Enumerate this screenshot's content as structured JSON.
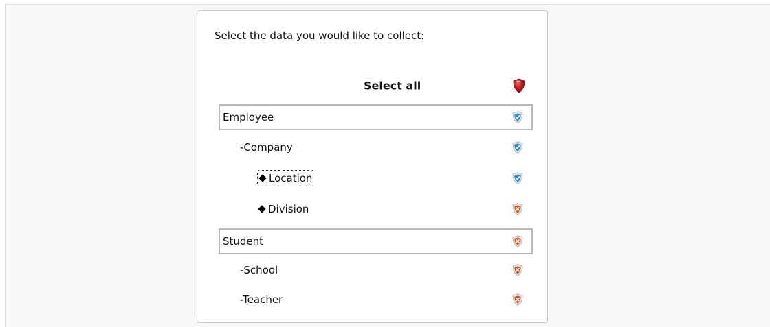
{
  "prompt_text": "Select the data you would like to collect:",
  "select_all": {
    "label": "Select all",
    "state": "partial",
    "icon": "shield-red-icon"
  },
  "colors": {
    "allowed_shield": "#2a8fc4",
    "blocked_shield": "#d9531e",
    "partial_shield": "#c21f1f",
    "group_border": "#b9b9b9"
  },
  "tree": [
    {
      "label": "Employee",
      "kind": "group",
      "state": "allowed",
      "icon": "shield-check-icon"
    },
    {
      "label": "-Company",
      "kind": "level1",
      "state": "allowed",
      "icon": "shield-check-icon"
    },
    {
      "label": "Location",
      "kind": "level2",
      "state": "allowed",
      "icon": "shield-check-icon",
      "bullet": "diamond",
      "focused": true
    },
    {
      "label": "Division",
      "kind": "level2",
      "state": "blocked",
      "icon": "shield-x-icon",
      "bullet": "diamond"
    },
    {
      "label": "Student",
      "kind": "group",
      "state": "blocked",
      "icon": "shield-x-icon"
    },
    {
      "label": "-School",
      "kind": "level1",
      "state": "blocked",
      "icon": "shield-x-icon"
    },
    {
      "label": "-Teacher",
      "kind": "level1",
      "state": "blocked",
      "icon": "shield-x-icon"
    }
  ]
}
